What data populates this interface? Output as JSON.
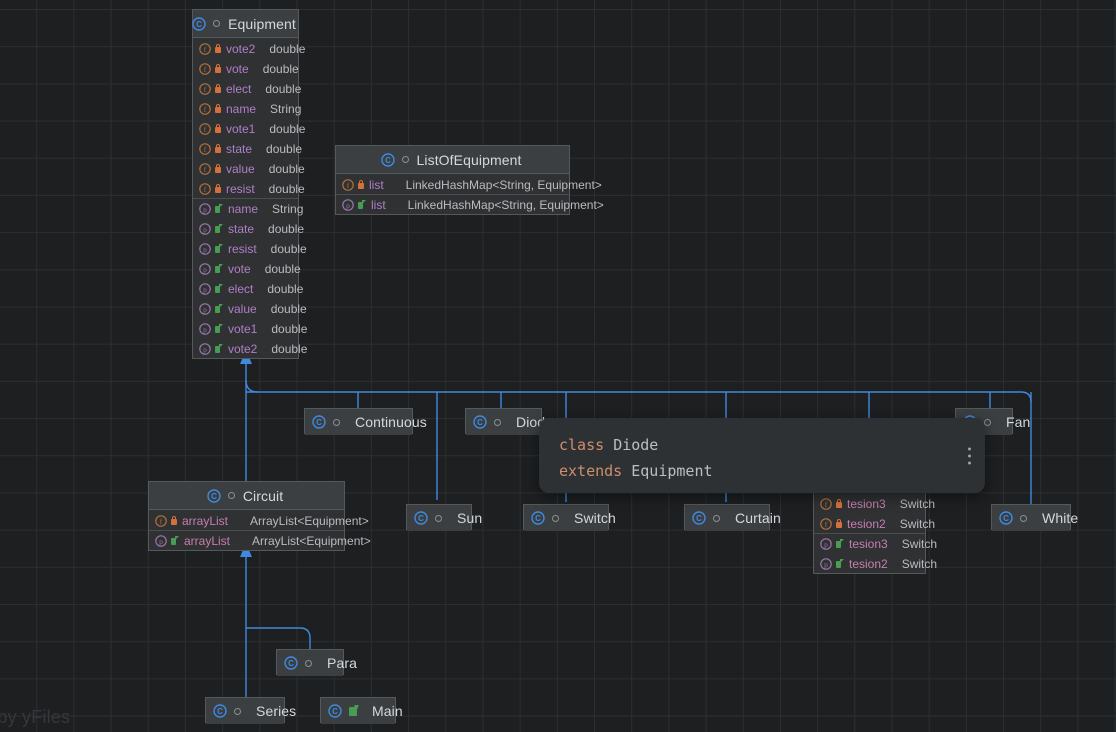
{
  "watermark": "d by yFiles",
  "colors": {
    "background": "#1d1f21",
    "grid": "#2c2f31",
    "edge": "#3f8ae0",
    "node_header": "#3b3f41",
    "node_body": "#2f3133",
    "node_border": "#55595b",
    "member_name": "#b07fc7",
    "member_type": "#b9bcc0",
    "keyword": "#cf8e6d",
    "class_icon": "#3f8ae0",
    "field_icon": "#b0713c",
    "property_icon": "#9876aa",
    "private_lock": "#d4713a",
    "public_arrow": "#499c54"
  },
  "tooltip": {
    "line1_keyword": "class",
    "line1_name": "Diode",
    "line2_keyword": "extends",
    "line2_name": "Equipment",
    "menu_icon": "more-vertical-icon"
  },
  "nodes": {
    "equipment": {
      "name": "Equipment",
      "icon": "class-icon",
      "visibility_icon": "package-private-dot-icon",
      "members": [
        {
          "kind": "field",
          "access": "private",
          "name": "vote2",
          "type": "double"
        },
        {
          "kind": "field",
          "access": "private",
          "name": "vote",
          "type": "double"
        },
        {
          "kind": "field",
          "access": "private",
          "name": "elect",
          "type": "double"
        },
        {
          "kind": "field",
          "access": "private",
          "name": "name",
          "type": "String"
        },
        {
          "kind": "field",
          "access": "private",
          "name": "vote1",
          "type": "double"
        },
        {
          "kind": "field",
          "access": "private",
          "name": "state",
          "type": "double"
        },
        {
          "kind": "field",
          "access": "private",
          "name": "value",
          "type": "double"
        },
        {
          "kind": "field",
          "access": "private",
          "name": "resist",
          "type": "double"
        },
        {
          "kind": "property",
          "access": "public",
          "name": "name",
          "type": "String"
        },
        {
          "kind": "property",
          "access": "public",
          "name": "state",
          "type": "double"
        },
        {
          "kind": "property",
          "access": "public",
          "name": "resist",
          "type": "double"
        },
        {
          "kind": "property",
          "access": "public",
          "name": "vote",
          "type": "double"
        },
        {
          "kind": "property",
          "access": "public",
          "name": "elect",
          "type": "double"
        },
        {
          "kind": "property",
          "access": "public",
          "name": "value",
          "type": "double"
        },
        {
          "kind": "property",
          "access": "public",
          "name": "vote1",
          "type": "double"
        },
        {
          "kind": "property",
          "access": "public",
          "name": "vote2",
          "type": "double"
        }
      ]
    },
    "list_of_equipment": {
      "name": "ListOfEquipment",
      "icon": "class-icon",
      "visibility_icon": "package-private-dot-icon",
      "members": [
        {
          "kind": "field",
          "access": "private",
          "name": "list",
          "type": "LinkedHashMap<String, Equipment>"
        },
        {
          "kind": "property",
          "access": "public",
          "name": "list",
          "type": "LinkedHashMap<String, Equipment>"
        }
      ]
    },
    "circuit": {
      "name": "Circuit",
      "icon": "class-icon",
      "visibility_icon": "package-private-dot-icon",
      "members": [
        {
          "kind": "field",
          "access": "private",
          "name": "arrayList",
          "type": "ArrayList<Equipment>"
        },
        {
          "kind": "property",
          "access": "public",
          "name": "arrayList",
          "type": "ArrayList<Equipment>"
        }
      ]
    },
    "hidden_switch_class": {
      "name": "",
      "members": [
        {
          "kind": "field",
          "access": "private",
          "name": "tesion3",
          "type": "Switch"
        },
        {
          "kind": "field",
          "access": "private",
          "name": "tesion2",
          "type": "Switch"
        },
        {
          "kind": "property",
          "access": "public",
          "name": "tesion3",
          "type": "Switch"
        },
        {
          "kind": "property",
          "access": "public",
          "name": "tesion2",
          "type": "Switch"
        }
      ]
    },
    "simple": [
      {
        "id": "continuous",
        "name": "Continuous",
        "icon": "class-icon",
        "visibility_icon": "package-private-dot-icon"
      },
      {
        "id": "diode",
        "name": "Diode",
        "icon": "class-icon",
        "visibility_icon": "package-private-dot-icon"
      },
      {
        "id": "fan",
        "name": "Fan",
        "icon": "class-icon",
        "visibility_icon": "package-private-dot-icon"
      },
      {
        "id": "sun",
        "name": "Sun",
        "icon": "class-icon",
        "visibility_icon": "package-private-dot-icon"
      },
      {
        "id": "switch",
        "name": "Switch",
        "icon": "class-icon",
        "visibility_icon": "package-private-dot-icon"
      },
      {
        "id": "curtain",
        "name": "Curtain",
        "icon": "class-icon",
        "visibility_icon": "package-private-dot-icon"
      },
      {
        "id": "white",
        "name": "White",
        "icon": "class-icon",
        "visibility_icon": "package-private-dot-icon"
      },
      {
        "id": "para",
        "name": "Para",
        "icon": "class-icon",
        "visibility_icon": "package-private-dot-icon"
      },
      {
        "id": "series",
        "name": "Series",
        "icon": "class-icon",
        "visibility_icon": "package-private-dot-icon"
      },
      {
        "id": "main",
        "name": "Main",
        "icon": "class-icon",
        "visibility_icon": "public-square-icon"
      }
    ]
  }
}
